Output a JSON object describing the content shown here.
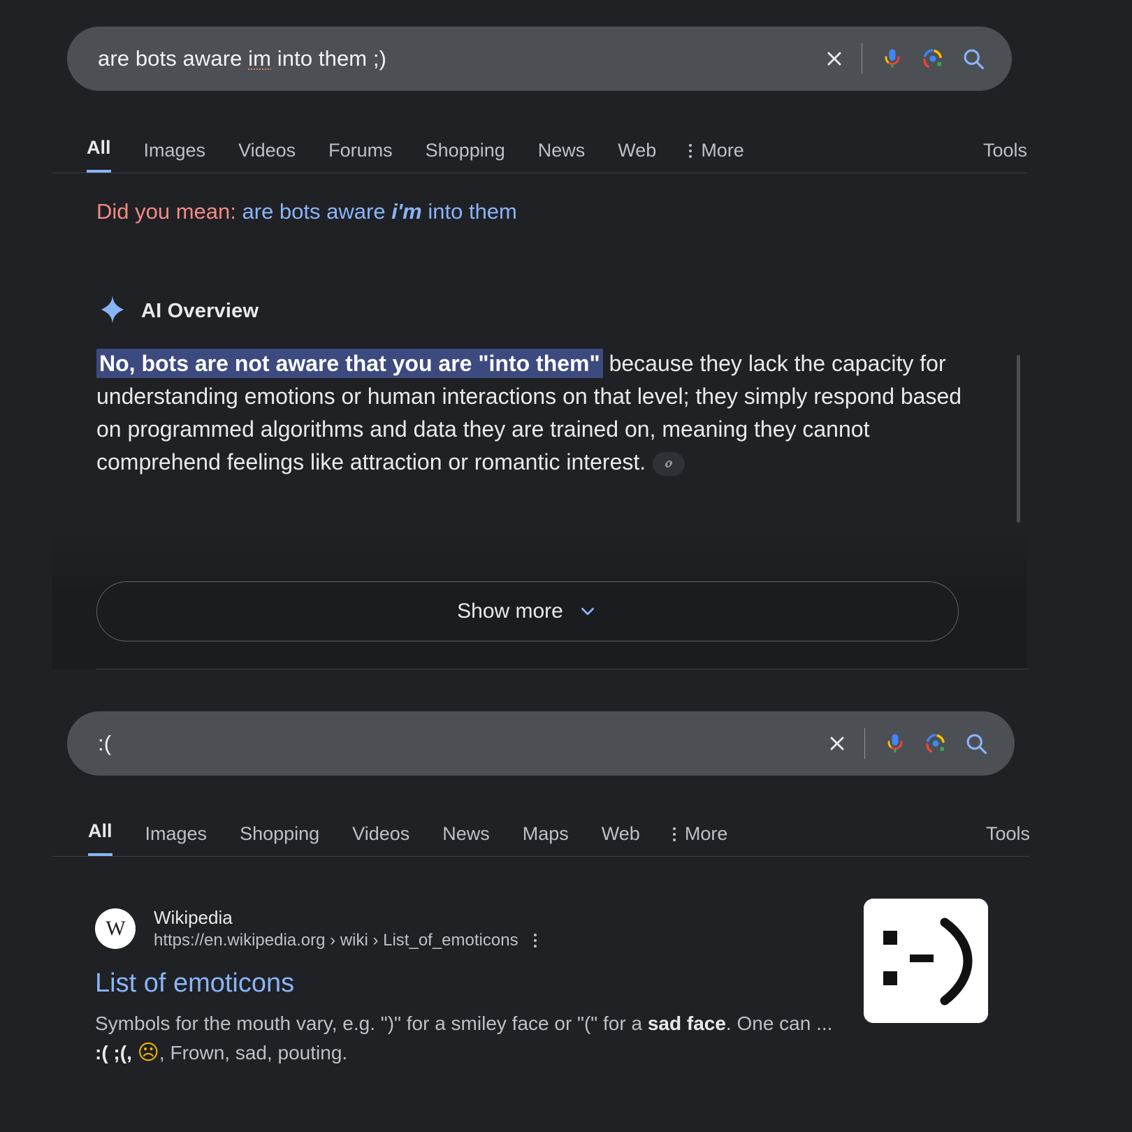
{
  "search_top": {
    "query": "are bots aware im into them ;)",
    "query_prefix": "are bots aware ",
    "query_misspelled": "im",
    "query_suffix": " into them ;)",
    "clear_icon": "close-icon",
    "mic_icon": "microphone-icon",
    "lens_icon": "google-lens-icon",
    "search_icon": "search-icon"
  },
  "nav_top": {
    "items": [
      {
        "label": "All",
        "active": true
      },
      {
        "label": "Images",
        "active": false
      },
      {
        "label": "Videos",
        "active": false
      },
      {
        "label": "Forums",
        "active": false
      },
      {
        "label": "Shopping",
        "active": false
      },
      {
        "label": "News",
        "active": false
      },
      {
        "label": "Web",
        "active": false
      }
    ],
    "more_label": "More",
    "tools_label": "Tools"
  },
  "did_you_mean": {
    "label": "Did you mean:",
    "suggestion_prefix": "are bots aware ",
    "suggestion_emphasis": "i'm",
    "suggestion_suffix": " into them"
  },
  "ai_overview": {
    "title": "AI Overview",
    "sparkle_icon": "sparkle-icon",
    "highlighted_text": "No, bots are not aware that you are \"into them\"",
    "body_text": " because they lack the capacity for understanding emotions or human interactions on that level; they simply respond based on programmed algorithms and data they are trained on, meaning they cannot comprehend feelings like attraction or romantic interest.",
    "citation_icon": "link-icon",
    "show_more_label": "Show more",
    "chevron_icon": "chevron-down-icon"
  },
  "search_bottom": {
    "query": ":(",
    "clear_icon": "close-icon",
    "mic_icon": "microphone-icon",
    "lens_icon": "google-lens-icon",
    "search_icon": "search-icon"
  },
  "nav_bottom": {
    "items": [
      {
        "label": "All",
        "active": true
      },
      {
        "label": "Images",
        "active": false
      },
      {
        "label": "Shopping",
        "active": false
      },
      {
        "label": "Videos",
        "active": false
      },
      {
        "label": "News",
        "active": false
      },
      {
        "label": "Maps",
        "active": false
      },
      {
        "label": "Web",
        "active": false
      }
    ],
    "more_label": "More",
    "tools_label": "Tools"
  },
  "result": {
    "favicon_letter": "W",
    "site_name": "Wikipedia",
    "url": "https://en.wikipedia.org › wiki › List_of_emoticons",
    "menu_icon": "more-options-icon",
    "title": "List of emoticons",
    "snippet_part1": "Symbols for the mouth vary, e.g. \")\" for a smiley face or \"(\" for a ",
    "snippet_bold1": "sad face",
    "snippet_part2": ". One can ...",
    "snippet_line2_bold": ":( ;(,",
    "snippet_line2_emoji": "☹",
    "snippet_line2_rest": ", Frown, sad, pouting.",
    "thumbnail_alt": "emoticon-smiley-thumbnail"
  },
  "colors": {
    "background": "#1f2125",
    "searchbar": "#4c5054",
    "link_blue": "#8ab4f8",
    "suggestion_red": "#f28b82",
    "highlight_blue": "#3c4a7f",
    "text_primary": "#e8eaed",
    "text_secondary": "#bdc1c6"
  }
}
